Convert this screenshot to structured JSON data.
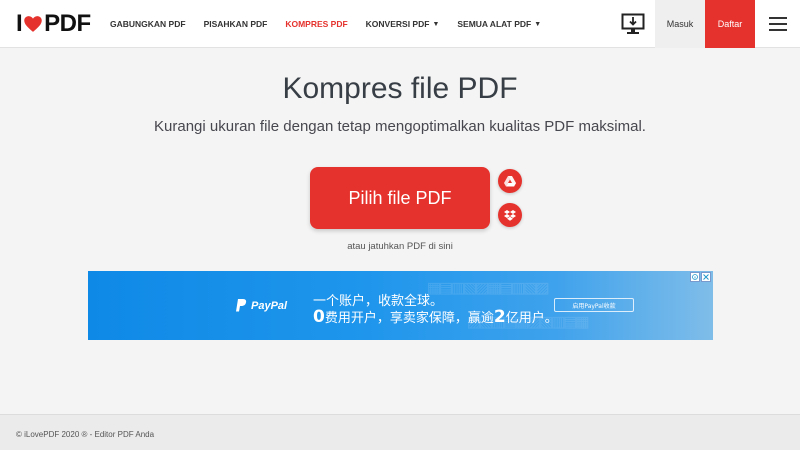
{
  "header": {
    "logo": {
      "left": "I",
      "right": "PDF"
    },
    "nav": [
      {
        "label": "GABUNGKAN PDF",
        "active": false,
        "dropdown": false
      },
      {
        "label": "PISAHKAN PDF",
        "active": false,
        "dropdown": false
      },
      {
        "label": "KOMPRES PDF",
        "active": true,
        "dropdown": false
      },
      {
        "label": "KONVERSI PDF",
        "active": false,
        "dropdown": true
      },
      {
        "label": "SEMUA ALAT PDF",
        "active": false,
        "dropdown": true
      }
    ],
    "desktop_icon": "desktop-download-icon",
    "login_label": "Masuk",
    "signup_label": "Daftar",
    "menu_icon": "hamburger-menu-icon"
  },
  "main": {
    "title": "Kompres file PDF",
    "subtitle": "Kurangi ukuran file dengan tetap mengoptimalkan kualitas PDF maksimal.",
    "pick_button_label": "Pilih file PDF",
    "google_drive_icon": "google-drive-icon",
    "dropbox_icon": "dropbox-icon",
    "drop_hint": "atau jatuhkan PDF di sini"
  },
  "ad": {
    "brand": "PayPal",
    "line1": "一个账户，收款全球。",
    "line2_parts": [
      "0",
      "费用开户，享卖家保障，赢逾",
      "2",
      "亿用户。"
    ],
    "cta": "启用PayPal收款"
  },
  "footer": {
    "text": "© iLovePDF 2020 ® - Editor PDF Anda"
  },
  "colors": {
    "brand_red": "#e5322d",
    "title_text": "#383e45",
    "ad_blue": "#0e89e6"
  }
}
